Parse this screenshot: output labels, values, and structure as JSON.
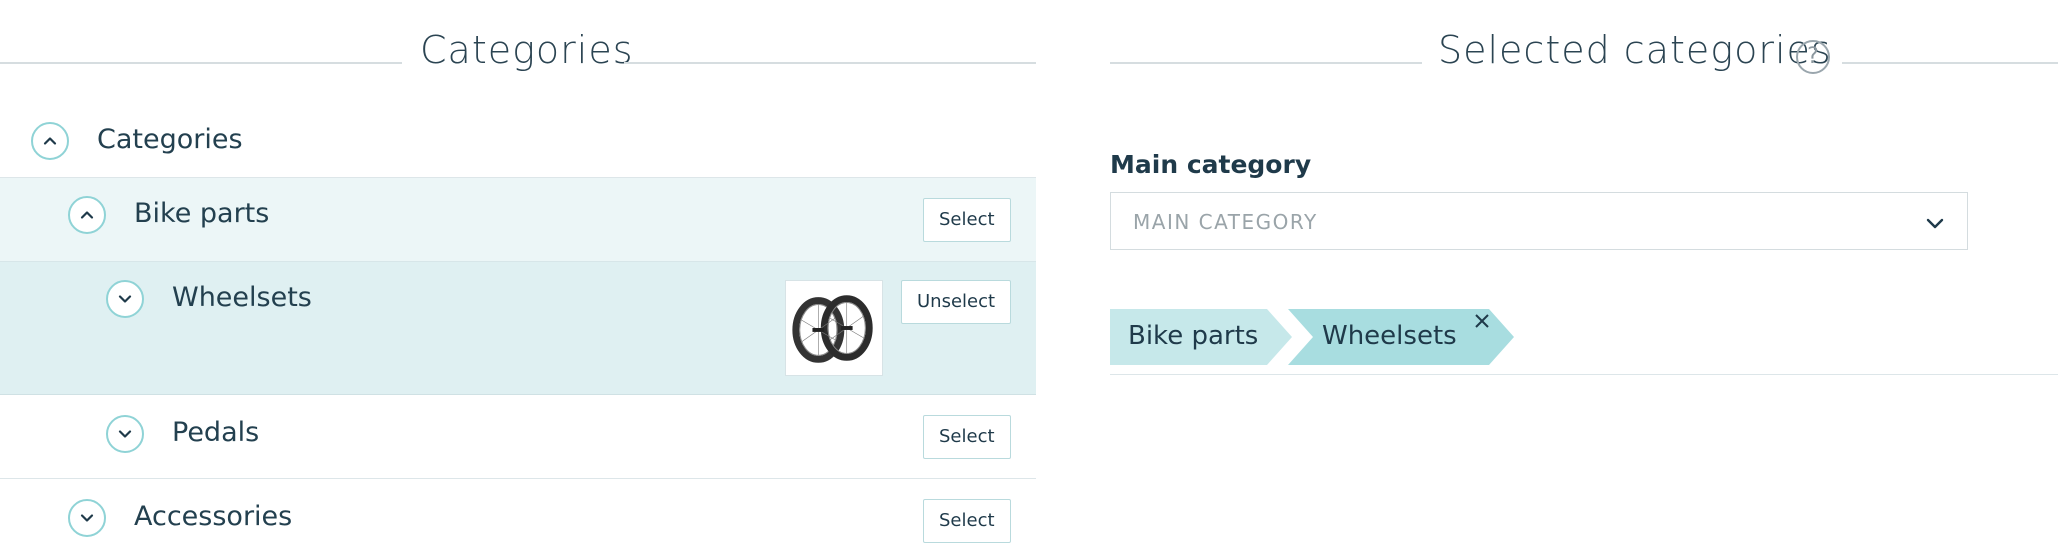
{
  "left": {
    "title": "Categories",
    "tree": {
      "root": {
        "label": "Categories",
        "state": "expanded"
      },
      "items": [
        {
          "label": "Bike parts",
          "state": "expanded",
          "button": "Select"
        },
        {
          "label": "Wheelsets",
          "state": "collapsed",
          "button": "Unselect",
          "image": "wheelset-thumbnail"
        },
        {
          "label": "Pedals",
          "state": "collapsed",
          "button": "Select"
        },
        {
          "label": "Accessories",
          "state": "collapsed",
          "button": "Select"
        }
      ]
    }
  },
  "right": {
    "title": "Selected categories",
    "help_icon": "?",
    "main_category": {
      "label": "Main category",
      "placeholder": "MAIN CATEGORY"
    },
    "breadcrumb": [
      {
        "label": "Bike parts"
      },
      {
        "label": "Wheelsets",
        "removable": true
      }
    ]
  },
  "colors": {
    "accent": "#8fd3d6",
    "row_selected_parent": "#ecf6f7",
    "row_selected": "#dff0f2",
    "crumb_light": "#c6e8ea",
    "crumb_dark": "#a8dde0",
    "text": "#1f3a4a"
  }
}
